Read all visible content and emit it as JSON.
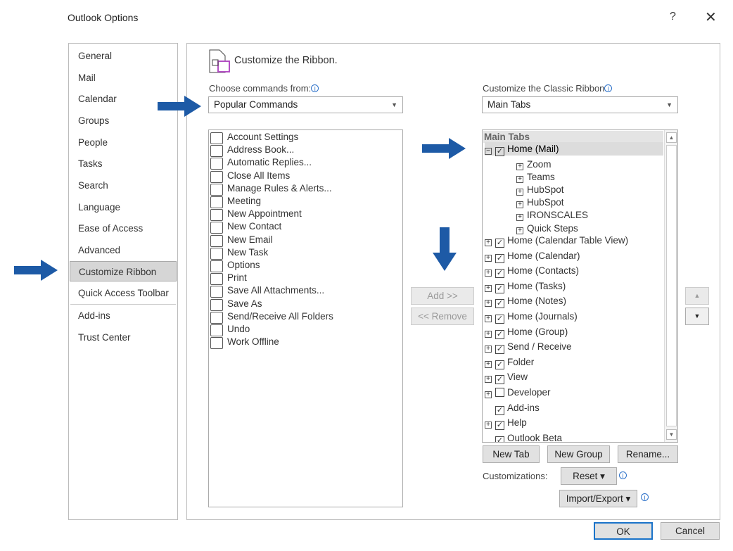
{
  "window": {
    "title": "Outlook Options",
    "help": "?",
    "close": "✕"
  },
  "nav": {
    "items": [
      "General",
      "Mail",
      "Calendar",
      "Groups",
      "People",
      "Tasks",
      "Search",
      "Language",
      "Ease of Access",
      "Advanced",
      "Customize Ribbon",
      "Quick Access Toolbar",
      "Add-ins",
      "Trust Center"
    ],
    "selected": "Customize Ribbon"
  },
  "main": {
    "heading": "Customize the Ribbon.",
    "choose_label": "Choose commands from:",
    "choose_value": "Popular Commands",
    "ribbon_label": "Customize the Classic Ribbon",
    "ribbon_value": "Main Tabs",
    "commands": [
      {
        "label": "Account Settings",
        "icon": "account-settings-icon"
      },
      {
        "label": "Address Book...",
        "icon": "address-book-icon"
      },
      {
        "label": "Automatic Replies...",
        "icon": "automatic-replies-icon"
      },
      {
        "label": "Close All Items",
        "icon": "close-all-items-icon"
      },
      {
        "label": "Manage Rules & Alerts...",
        "icon": "rules-alerts-icon"
      },
      {
        "label": "Meeting",
        "icon": "meeting-icon"
      },
      {
        "label": "New Appointment",
        "icon": "appointment-icon"
      },
      {
        "label": "New Contact",
        "icon": "contact-icon"
      },
      {
        "label": "New Email",
        "icon": "email-icon"
      },
      {
        "label": "New Task",
        "icon": "task-icon"
      },
      {
        "label": "Options",
        "icon": "options-icon"
      },
      {
        "label": "Print",
        "icon": "print-icon"
      },
      {
        "label": "Save All Attachments...",
        "icon": "save-attachments-icon"
      },
      {
        "label": "Save As",
        "icon": "save-as-icon"
      },
      {
        "label": "Send/Receive All Folders",
        "icon": "send-receive-icon"
      },
      {
        "label": "Undo",
        "icon": "undo-icon"
      },
      {
        "label": "Work Offline",
        "icon": "work-offline-icon"
      }
    ],
    "tree_header": "Main Tabs",
    "tree": [
      {
        "label": "Home (Mail)",
        "level": 0,
        "expander": "minus",
        "checked": true,
        "selected": true
      },
      {
        "label": "Zoom",
        "level": 1,
        "expander": "plus"
      },
      {
        "label": "Teams",
        "level": 1,
        "expander": "plus"
      },
      {
        "label": "HubSpot",
        "level": 1,
        "expander": "plus"
      },
      {
        "label": "HubSpot",
        "level": 1,
        "expander": "plus"
      },
      {
        "label": "IRONSCALES",
        "level": 1,
        "expander": "plus"
      },
      {
        "label": "Quick Steps",
        "level": 1,
        "expander": "plus"
      },
      {
        "label": "Home (Calendar Table View)",
        "level": 0,
        "expander": "plus",
        "checked": true
      },
      {
        "label": "Home (Calendar)",
        "level": 0,
        "expander": "plus",
        "checked": true
      },
      {
        "label": "Home (Contacts)",
        "level": 0,
        "expander": "plus",
        "checked": true
      },
      {
        "label": "Home (Tasks)",
        "level": 0,
        "expander": "plus",
        "checked": true
      },
      {
        "label": "Home (Notes)",
        "level": 0,
        "expander": "plus",
        "checked": true
      },
      {
        "label": "Home (Journals)",
        "level": 0,
        "expander": "plus",
        "checked": true
      },
      {
        "label": "Home (Group)",
        "level": 0,
        "expander": "plus",
        "checked": true
      },
      {
        "label": "Send / Receive",
        "level": 0,
        "expander": "plus",
        "checked": true
      },
      {
        "label": "Folder",
        "level": 0,
        "expander": "plus",
        "checked": true
      },
      {
        "label": "View",
        "level": 0,
        "expander": "plus",
        "checked": true
      },
      {
        "label": "Developer",
        "level": 0,
        "expander": "plus",
        "checked": false
      },
      {
        "label": "Add-ins",
        "level": 0,
        "expander": "none",
        "checked": true
      },
      {
        "label": "Help",
        "level": 0,
        "expander": "plus",
        "checked": true
      },
      {
        "label": "Outlook Beta",
        "level": 0,
        "expander": "none",
        "checked": true
      }
    ],
    "add": "Add >>",
    "remove": "<< Remove",
    "new_tab": "New Tab",
    "new_group": "New Group",
    "rename": "Rename...",
    "customizations_label": "Customizations:",
    "reset": "Reset ▾",
    "import_export": "Import/Export ▾"
  },
  "footer": {
    "ok": "OK",
    "cancel": "Cancel"
  },
  "colors": {
    "arrow": "#1d5aa6",
    "selected_nav": "#d6d6d6"
  }
}
